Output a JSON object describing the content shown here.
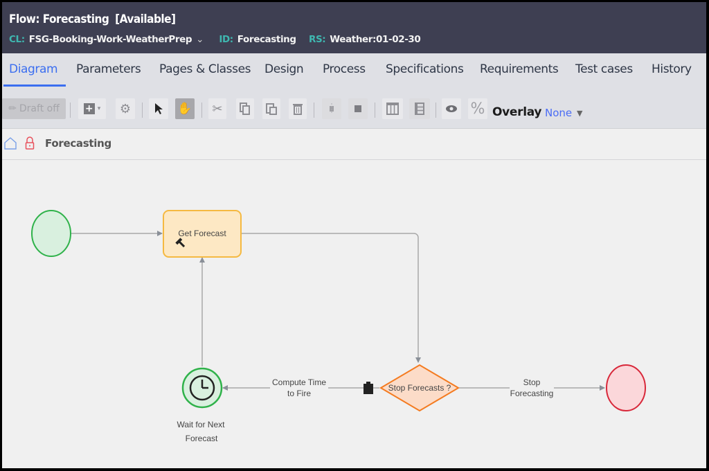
{
  "header": {
    "title": "Flow: Forecasting",
    "status": "[Available]",
    "cl_label": "CL:",
    "cl_value": "FSG-Booking-Work-WeatherPrep",
    "id_label": "ID:",
    "id_value": "Forecasting",
    "rs_label": "RS:",
    "rs_value": "Weather:01-02-30"
  },
  "tabs": [
    {
      "label": "Diagram",
      "active": true
    },
    {
      "label": "Parameters"
    },
    {
      "label": "Pages & Classes"
    },
    {
      "label": "Design"
    },
    {
      "label": "Process"
    },
    {
      "label": "Specifications"
    },
    {
      "label": "Requirements"
    },
    {
      "label": "Test cases"
    },
    {
      "label": "History"
    }
  ],
  "toolbar": {
    "draft_label": "Draft off",
    "icons": [
      "pencil-icon",
      "add-shape-icon",
      "gear-icon",
      "pointer-icon",
      "hand-icon",
      "cut-icon",
      "copy-icon",
      "paste-icon",
      "delete-icon",
      "align-icon",
      "fit-icon",
      "columns-icon",
      "rows-icon",
      "eye-icon",
      "percent-icon"
    ],
    "overlay_label": "Overlay",
    "overlay_value": "None"
  },
  "breadcrumb": {
    "title": "Forecasting"
  },
  "diagram": {
    "colors": {
      "start": "#2fb24a",
      "assignment": "#f5b941",
      "decision": "#f47b20",
      "end": "#d8283a",
      "connector": "#9a9a9a"
    },
    "nodes": {
      "start": "",
      "get_forecast": "Get Forecast",
      "wait": [
        "Wait for Next",
        "Forecast"
      ],
      "decision": "Stop Forecasts ?",
      "end": ""
    },
    "connectors": {
      "compute": [
        "Compute Time",
        "to Fire"
      ],
      "stop": [
        "Stop",
        "Forecasting"
      ]
    }
  }
}
